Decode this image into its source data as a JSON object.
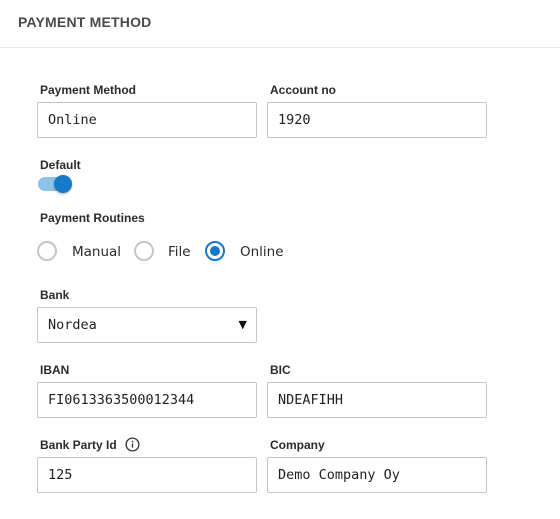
{
  "header": {
    "title": "PAYMENT METHOD"
  },
  "form": {
    "payment_method": {
      "label": "Payment Method",
      "value": "Online"
    },
    "account_no": {
      "label": "Account no",
      "value": "1920"
    },
    "default": {
      "label": "Default",
      "on": true
    },
    "payment_routines": {
      "label": "Payment Routines",
      "options": [
        {
          "label": "Manual",
          "selected": false
        },
        {
          "label": "File",
          "selected": false
        },
        {
          "label": "Online",
          "selected": true
        }
      ]
    },
    "bank": {
      "label": "Bank",
      "value": "Nordea"
    },
    "iban": {
      "label": "IBAN",
      "value": "FI0613363500012344"
    },
    "bic": {
      "label": "BIC",
      "value": "NDEAFIHH"
    },
    "bank_party_id": {
      "label": "Bank Party Id",
      "value": "125",
      "icon": "info-icon"
    },
    "company": {
      "label": "Company",
      "value": "Demo Company Oy"
    }
  },
  "colors": {
    "accent": "#1679c9",
    "toggle_track": "#8dc3ea",
    "border": "#c6c6c6"
  }
}
